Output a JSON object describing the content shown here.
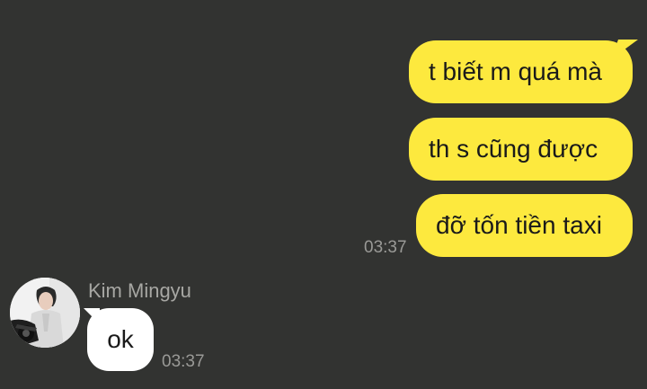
{
  "theme": {
    "background": "#323331",
    "outgoing_bubble": "#fde93e",
    "incoming_bubble": "#ffffff",
    "timestamp_color": "#9a9a97",
    "sender_name_color": "#a7a7a3"
  },
  "outgoing": {
    "messages": [
      "t biết m quá mà",
      "th s cũng được",
      "đỡ tốn tiền taxi"
    ],
    "time": "03:37"
  },
  "incoming": {
    "sender_name": "Kim Mingyu",
    "avatar_icon": "profile-photo",
    "message": "ok",
    "time": "03:37"
  }
}
